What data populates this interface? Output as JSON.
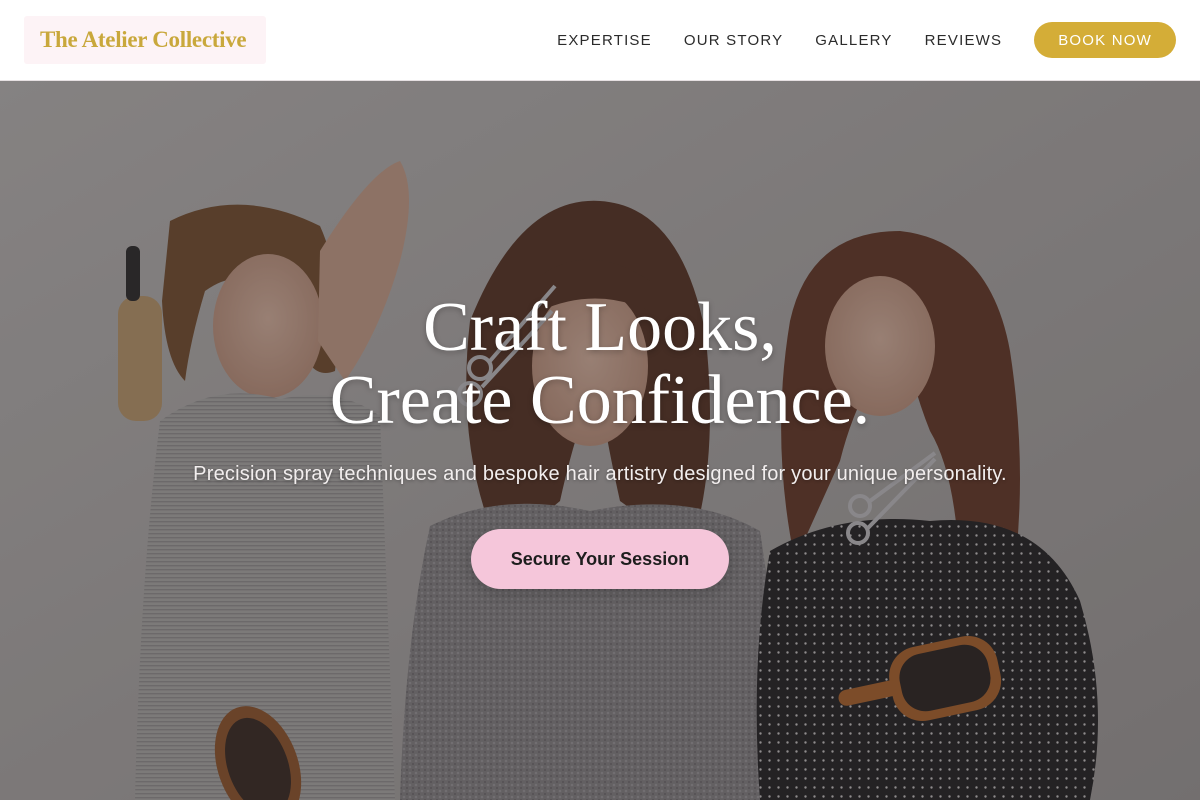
{
  "brand": {
    "name": "The Atelier Collective",
    "color": "#c9a83c"
  },
  "nav": {
    "items": [
      {
        "label": "EXPERTISE"
      },
      {
        "label": "OUR STORY"
      },
      {
        "label": "GALLERY"
      },
      {
        "label": "REVIEWS"
      }
    ],
    "cta_label": "BOOK NOW",
    "cta_color": "#d4ad37"
  },
  "hero": {
    "headline_line1": "Craft Looks,",
    "headline_line2": "Create Confidence.",
    "subheadline": "Precision spray techniques and bespoke hair artistry designed for your unique personality.",
    "cta_label": "Secure Your Session",
    "cta_color": "#f5c6da",
    "background_image": "three-stylists-holding-brushes-and-scissors"
  }
}
